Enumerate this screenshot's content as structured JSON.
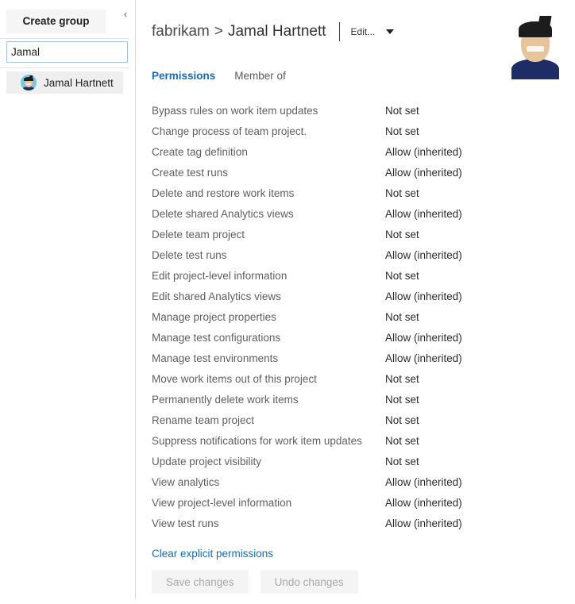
{
  "sidebar": {
    "create_group_label": "Create group",
    "collapse_icon": "chevron-left-icon",
    "search": {
      "value": "Jamal",
      "placeholder": ""
    },
    "identities": [
      {
        "name": "Jamal Hartnett",
        "avatar": "user-avatar"
      }
    ]
  },
  "header": {
    "breadcrumb": {
      "org": "fabrikam",
      "separator": ">",
      "name": "Jamal Hartnett"
    },
    "edit_menu_label": "Edit...",
    "edit_caret_icon": "chevron-down-icon",
    "avatar": "user-avatar-large"
  },
  "tabs": [
    {
      "label": "Permissions",
      "active": true
    },
    {
      "label": "Member of",
      "active": false
    }
  ],
  "permissions": [
    {
      "name": "Bypass rules on work item updates",
      "value": "Not set"
    },
    {
      "name": "Change process of team project.",
      "value": "Not set"
    },
    {
      "name": "Create tag definition",
      "value": "Allow (inherited)"
    },
    {
      "name": "Create test runs",
      "value": "Allow (inherited)"
    },
    {
      "name": "Delete and restore work items",
      "value": "Not set"
    },
    {
      "name": "Delete shared Analytics views",
      "value": "Allow (inherited)"
    },
    {
      "name": "Delete team project",
      "value": "Not set"
    },
    {
      "name": "Delete test runs",
      "value": "Allow (inherited)"
    },
    {
      "name": "Edit project-level information",
      "value": "Not set"
    },
    {
      "name": "Edit shared Analytics views",
      "value": "Allow (inherited)"
    },
    {
      "name": "Manage project properties",
      "value": "Not set"
    },
    {
      "name": "Manage test configurations",
      "value": "Allow (inherited)"
    },
    {
      "name": "Manage test environments",
      "value": "Allow (inherited)"
    },
    {
      "name": "Move work items out of this project",
      "value": "Not set"
    },
    {
      "name": "Permanently delete work items",
      "value": "Not set"
    },
    {
      "name": "Rename team project",
      "value": "Not set"
    },
    {
      "name": "Suppress notifications for work item updates",
      "value": "Not set"
    },
    {
      "name": "Update project visibility",
      "value": "Not set"
    },
    {
      "name": "View analytics",
      "value": "Allow (inherited)"
    },
    {
      "name": "View project-level information",
      "value": "Allow (inherited)"
    },
    {
      "name": "View test runs",
      "value": "Allow (inherited)"
    }
  ],
  "footer": {
    "clear_link_label": "Clear explicit permissions",
    "save_label": "Save changes",
    "undo_label": "Undo changes"
  },
  "colors": {
    "accent_blue": "#106ebe",
    "selected_item_bg": "#efefef",
    "button_bg": "#f5f5f5",
    "divider": "#dcdcdc",
    "avatar_bg": "#74c6e8"
  }
}
